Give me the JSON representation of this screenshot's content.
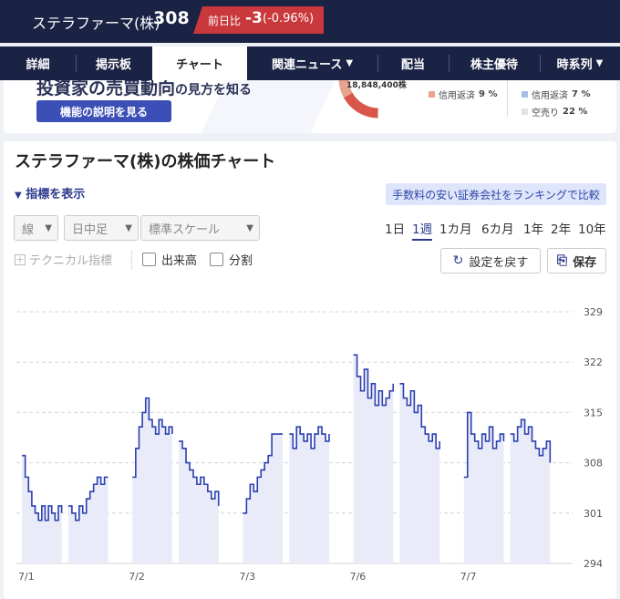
{
  "header": {
    "company": "ステラファーマ(株)",
    "price": "308",
    "change_label": "前日比",
    "change_value": "-3",
    "change_pct": "(-0.96%)",
    "down_color": "#c9383a"
  },
  "nav": {
    "tabs": [
      {
        "label": "詳細",
        "dropdown": false
      },
      {
        "label": "掲示板",
        "dropdown": false
      },
      {
        "label": "チャート",
        "dropdown": false,
        "active": true
      },
      {
        "label": "関連ニュース",
        "dropdown": true
      },
      {
        "label": "配当",
        "dropdown": false
      },
      {
        "label": "株主優待",
        "dropdown": false
      },
      {
        "label": "時系列",
        "dropdown": true
      }
    ]
  },
  "promo": {
    "heading": "投資家の売買動向",
    "heading_suffix": "の見方を知る",
    "button_label": "機能の説明を見る",
    "donut_total": "18,848,400株",
    "legend": [
      {
        "label": "信用返済",
        "value": "9 %",
        "color": "#e8a48f"
      },
      {
        "label": "信用返済",
        "value": "7 %",
        "color": "#a9bde8"
      },
      {
        "label": "空売り",
        "value": "22 %",
        "color": "#e2e2e2"
      }
    ]
  },
  "main": {
    "title": "ステラファーマ(株)の株価チャート",
    "indicator_toggle": "指標を表示",
    "compare_link": "手数料の安い証券会社をランキングで比較",
    "selects": [
      {
        "value": "線"
      },
      {
        "value": "日中足"
      },
      {
        "value": "標準スケール"
      }
    ],
    "periods": [
      "1日",
      "1週",
      "1カ月",
      "6カ月",
      "1年",
      "2年",
      "10年"
    ],
    "active_period": "1週",
    "technical_label": "テクニカル指標",
    "checkbox_volume": "出来高",
    "checkbox_split": "分割",
    "reset_button": "設定を戻す",
    "save_button": "保存"
  },
  "chart_data": {
    "type": "line",
    "y_ticks": [
      294,
      301,
      308,
      315,
      322,
      329
    ],
    "ylim": [
      294,
      329
    ],
    "x_labels": [
      "7/1",
      "7/2",
      "7/3",
      "7/6",
      "7/7"
    ],
    "line_color": "#2b3fb0",
    "fill_color": "#e9ecf8",
    "sessions": [
      {
        "date": "7/1",
        "am": [
          309,
          306,
          304,
          302,
          301,
          300,
          302,
          300,
          302,
          301,
          300,
          302,
          301
        ],
        "pm": [
          302,
          301,
          300,
          302,
          301,
          303,
          304,
          305,
          306,
          305,
          306,
          306
        ]
      },
      {
        "date": "7/2",
        "am": [
          306,
          310,
          313,
          315,
          317,
          314,
          313,
          312,
          314,
          313,
          312,
          313,
          312
        ],
        "pm": [
          311,
          310,
          308,
          307,
          306,
          305,
          306,
          305,
          304,
          303,
          304,
          302
        ]
      },
      {
        "date": "7/3",
        "am": [
          301,
          303,
          305,
          304,
          306,
          307,
          308,
          309,
          312,
          312,
          312,
          312
        ],
        "pm": [
          312,
          310,
          313,
          312,
          311,
          312,
          310,
          312,
          313,
          312,
          311,
          312
        ]
      },
      {
        "date": "7/6",
        "am": [
          323,
          320,
          318,
          321,
          317,
          319,
          316,
          318,
          316,
          317,
          318,
          319
        ],
        "pm": [
          319,
          317,
          316,
          318,
          315,
          316,
          313,
          312,
          311,
          312,
          310,
          311
        ]
      },
      {
        "date": "7/7",
        "am": [
          306,
          315,
          312,
          311,
          310,
          312,
          311,
          313,
          310,
          311,
          312,
          311
        ],
        "pm": [
          312,
          311,
          313,
          314,
          312,
          313,
          311,
          310,
          309,
          310,
          311,
          308
        ]
      }
    ]
  }
}
